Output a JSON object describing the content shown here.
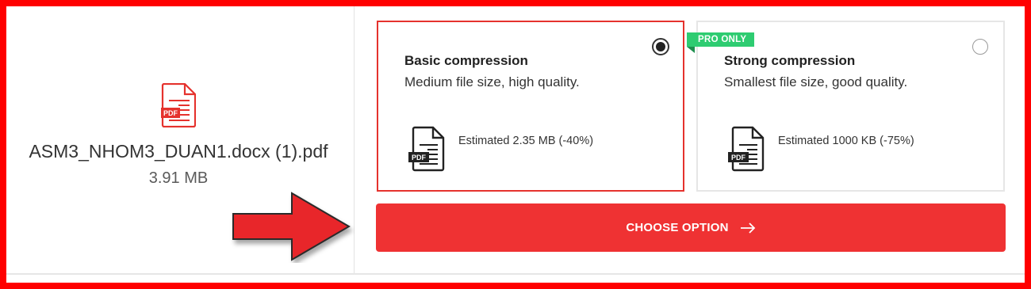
{
  "file": {
    "name": "ASM3_NHOM3_DUAN1.docx (1).pdf",
    "size": "3.91 MB",
    "icon": "pdf-file-icon"
  },
  "options": [
    {
      "title": "Basic compression",
      "description": "Medium file size, high quality.",
      "estimate": "Estimated 2.35 MB (-40%)",
      "selected": true,
      "icon": "pdf-document-icon"
    },
    {
      "title": "Strong compression",
      "description": "Smallest file size, good quality.",
      "estimate": "Estimated 1000 KB (-75%)",
      "selected": false,
      "badge": "PRO ONLY",
      "icon": "pdf-document-icon"
    }
  ],
  "action": {
    "label": "CHOOSE OPTION",
    "icon": "arrow-right-icon"
  },
  "colors": {
    "accent": "#ef3233",
    "selected_border": "#e5322d",
    "pro_badge": "#2ecc71",
    "annotation_frame": "#ff0000"
  }
}
